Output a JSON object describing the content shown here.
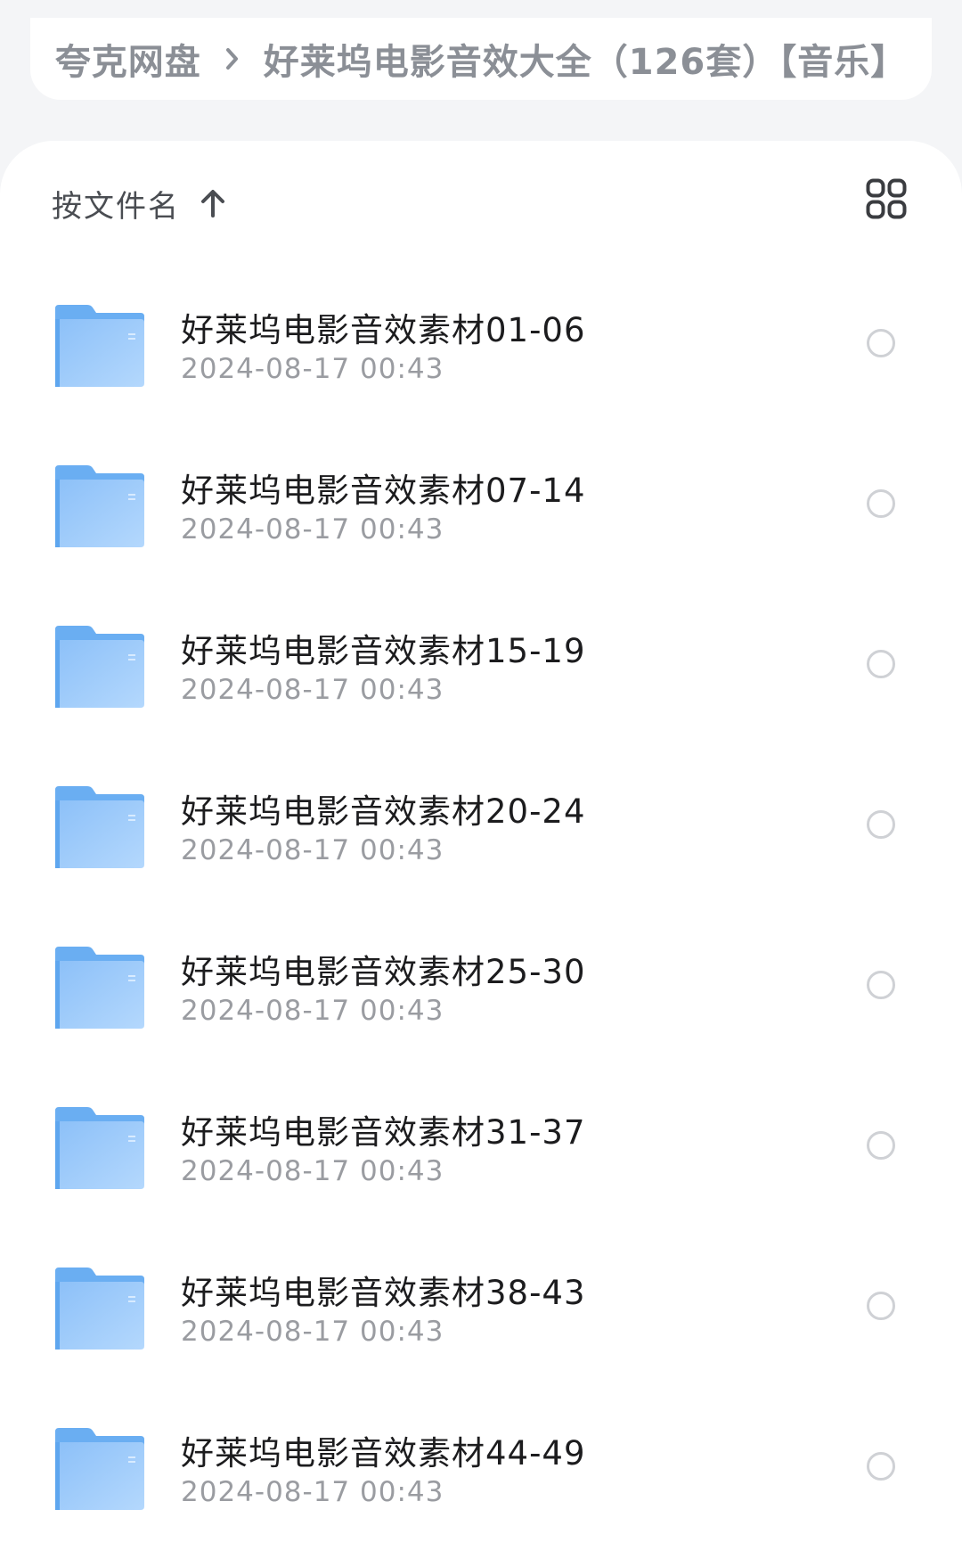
{
  "breadcrumb": {
    "root": "夸克网盘",
    "current": "好莱坞电影音效大全（126套）【音乐】"
  },
  "sort": {
    "label": "按文件名",
    "direction_icon": "arrow-up-icon"
  },
  "view_toggle_icon": "grid-view-icon",
  "files": [
    {
      "name": "好莱坞电影音效素材01-06",
      "date": "2024-08-17 00:43"
    },
    {
      "name": "好莱坞电影音效素材07-14",
      "date": "2024-08-17 00:43"
    },
    {
      "name": "好莱坞电影音效素材15-19",
      "date": "2024-08-17 00:43"
    },
    {
      "name": "好莱坞电影音效素材20-24",
      "date": "2024-08-17 00:43"
    },
    {
      "name": "好莱坞电影音效素材25-30",
      "date": "2024-08-17 00:43"
    },
    {
      "name": "好莱坞电影音效素材31-37",
      "date": "2024-08-17 00:43"
    },
    {
      "name": "好莱坞电影音效素材38-43",
      "date": "2024-08-17 00:43"
    },
    {
      "name": "好莱坞电影音效素材44-49",
      "date": "2024-08-17 00:43"
    }
  ],
  "colors": {
    "folder_back": "#6fb0f2",
    "folder_front": "#9cc9fb",
    "accent_text": "#8b8f96",
    "circle": "#cfd1d5"
  }
}
